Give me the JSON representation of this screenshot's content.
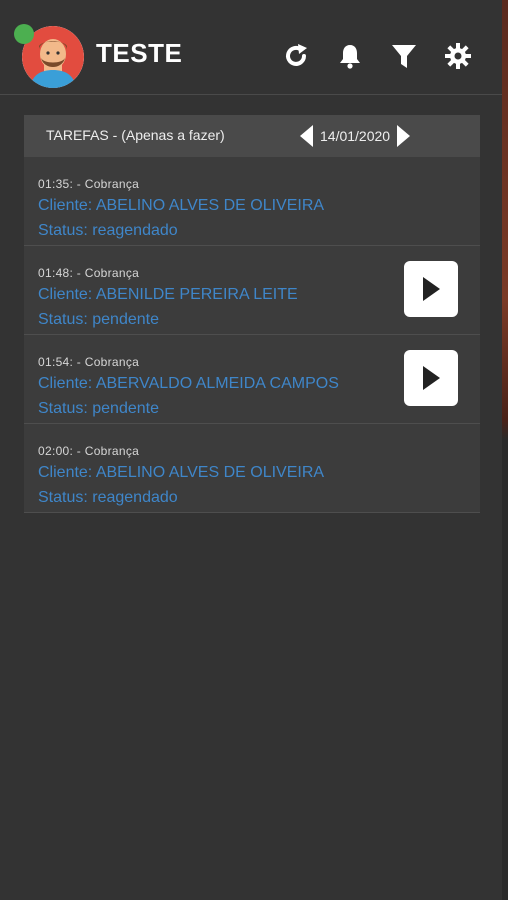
{
  "header": {
    "title": "TESTE",
    "status_color": "#4caf50",
    "icons": [
      "refresh-icon",
      "bell-icon",
      "filter-icon",
      "gear-icon"
    ]
  },
  "tasks": {
    "heading": "TAREFAS - (Apenas a fazer)",
    "date": "14/01/2020",
    "items": [
      {
        "time": "01:35: - Cobrança",
        "client": "Cliente: ABELINO ALVES DE OLIVEIRA",
        "status": "Status: reagendado",
        "has_play": false
      },
      {
        "time": "01:48: - Cobrança",
        "client": "Cliente: ABENILDE PEREIRA LEITE",
        "status": "Status: pendente",
        "has_play": true
      },
      {
        "time": "01:54: - Cobrança",
        "client": "Cliente: ABERVALDO ALMEIDA CAMPOS",
        "status": "Status: pendente",
        "has_play": true
      },
      {
        "time": "02:00: - Cobrança",
        "client": "Cliente: ABELINO ALVES DE OLIVEIRA",
        "status": "Status: reagendado",
        "has_play": false
      }
    ]
  },
  "colors": {
    "background": "#333333",
    "link": "#3f86c9",
    "header_bar": "#4a4a4a"
  }
}
